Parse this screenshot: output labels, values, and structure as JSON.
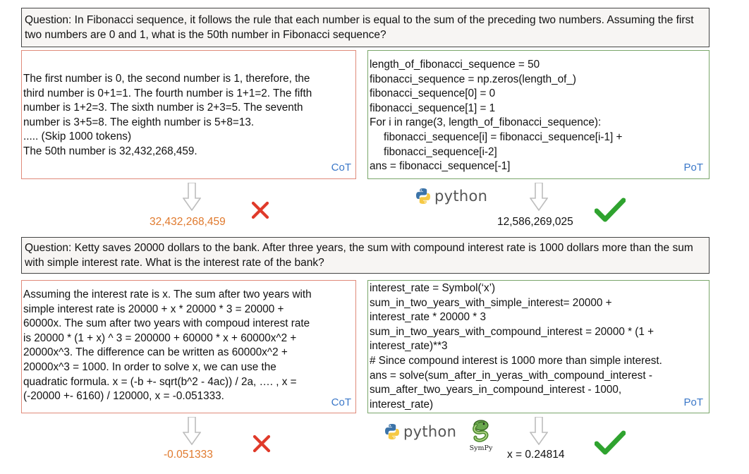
{
  "example1": {
    "question": "Question: In Fibonacci sequence, it follows the rule that each number is equal to the sum of the preceding two numbers. Assuming the first two numbers are 0 and 1, what is the 50th number in Fibonacci sequence?",
    "cot": {
      "lines": [
        "The first number is 0, the second number is 1, therefore, the",
        "third number is 0+1=1. The fourth number is 1+1=2. The fifth",
        "number is 1+2=3. The sixth number is 2+3=5. The seventh",
        "number is 3+5=8. The eighth number is 5+8=13.",
        "..... (Skip 1000 tokens)",
        "The 50th number is 32,432,268,459."
      ],
      "tag": "CoT",
      "answer": "32,432,268,459",
      "verdict": "wrong"
    },
    "pot": {
      "lines": [
        "length_of_fibonacci_sequence = 50",
        "fibonacci_sequence = np.zeros(length_of_)",
        "fibonacci_sequence[0] = 0",
        "fibonacci_sequence[1] = 1",
        "For i in range(3, length_of_fibonacci_sequence):",
        "fibonacci_sequence[i] = fibonacci_sequence[i-1] +",
        "fibonacci_sequence[i-2]",
        "ans = fibonacci_sequence[-1]"
      ],
      "tag": "PoT",
      "tool_label": "python",
      "answer": "12,586,269,025",
      "verdict": "correct"
    }
  },
  "example2": {
    "question": "Question: Ketty saves 20000 dollars to the bank. After three years, the sum with compound interest rate is 1000 dollars more than the sum with simple interest rate. What is the interest rate of the bank?",
    "cot": {
      "lines": [
        "Assuming the interest rate is x. The sum after two years with",
        "simple interest rate is 20000 + x * 20000 * 3 = 20000 +",
        "60000x. The sum after two years with compoud interest rate",
        "is 20000 * (1 + x) ^ 3 = 200000 + 60000 * x + 60000x^2 +",
        "20000x^3. The difference can be written as  60000x^2 +",
        "20000x^3 = 1000. In order to solve x, we can use the",
        "quadratic formula. x = (-b +- sqrt(b^2 - 4ac)) / 2a, …. , x =",
        "(-20000 +- 6160) / 120000, x = -0.051333."
      ],
      "tag": "CoT",
      "answer": "-0.051333",
      "verdict": "wrong"
    },
    "pot": {
      "lines": [
        "interest_rate = Symbol(‘x’)",
        "sum_in_two_years_with_simple_interest= 20000 +",
        "interest_rate * 20000 * 3",
        "sum_in_two_years_with_compound_interest = 20000 * (1 +",
        "interest_rate)**3",
        "# Since compound interest is 1000 more than simple interest.",
        "ans = solve(sum_after_in_yeras_with_compound_interest -",
        "sum_after_two_years_in_compound_interest - 1000,",
        "interest_rate)"
      ],
      "tag": "PoT",
      "tool_label": "python",
      "tool2_label": "SymPy",
      "answer": "x = 0.24814",
      "verdict": "correct"
    }
  },
  "colors": {
    "cot_border": "#e08a7a",
    "pot_border": "#7aa66a",
    "tag": "#3a77c8",
    "wrong_answer": "#e07a2e",
    "cross": "#e03a2a",
    "check": "#2fa32f",
    "arrow": "#bdbdbd"
  },
  "icons": [
    "python-logo-icon",
    "sympy-logo-icon",
    "down-arrow-icon",
    "cross-icon",
    "check-icon"
  ]
}
